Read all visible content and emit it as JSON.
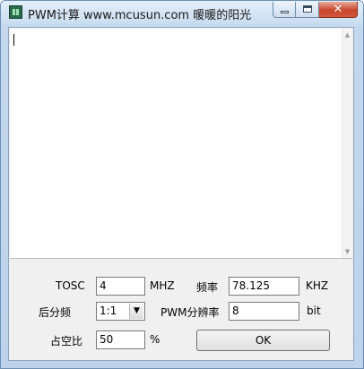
{
  "window": {
    "title": "PWM计算 www.mcusun.com  暖暖的阳光"
  },
  "output": {
    "text": ""
  },
  "form": {
    "tosc_label": "TOSC",
    "tosc_value": "4",
    "tosc_unit": "MHZ",
    "freq_label": "频率",
    "freq_value": "78.125",
    "freq_unit": "KHZ",
    "postscale_label": "后分频",
    "postscale_value": "1:1",
    "pwm_res_label": "PWM分辨率",
    "pwm_res_value": "8",
    "pwm_res_unit": "bit",
    "duty_label": "占空比",
    "duty_value": "50",
    "duty_unit": "%",
    "ok_label": "OK"
  }
}
